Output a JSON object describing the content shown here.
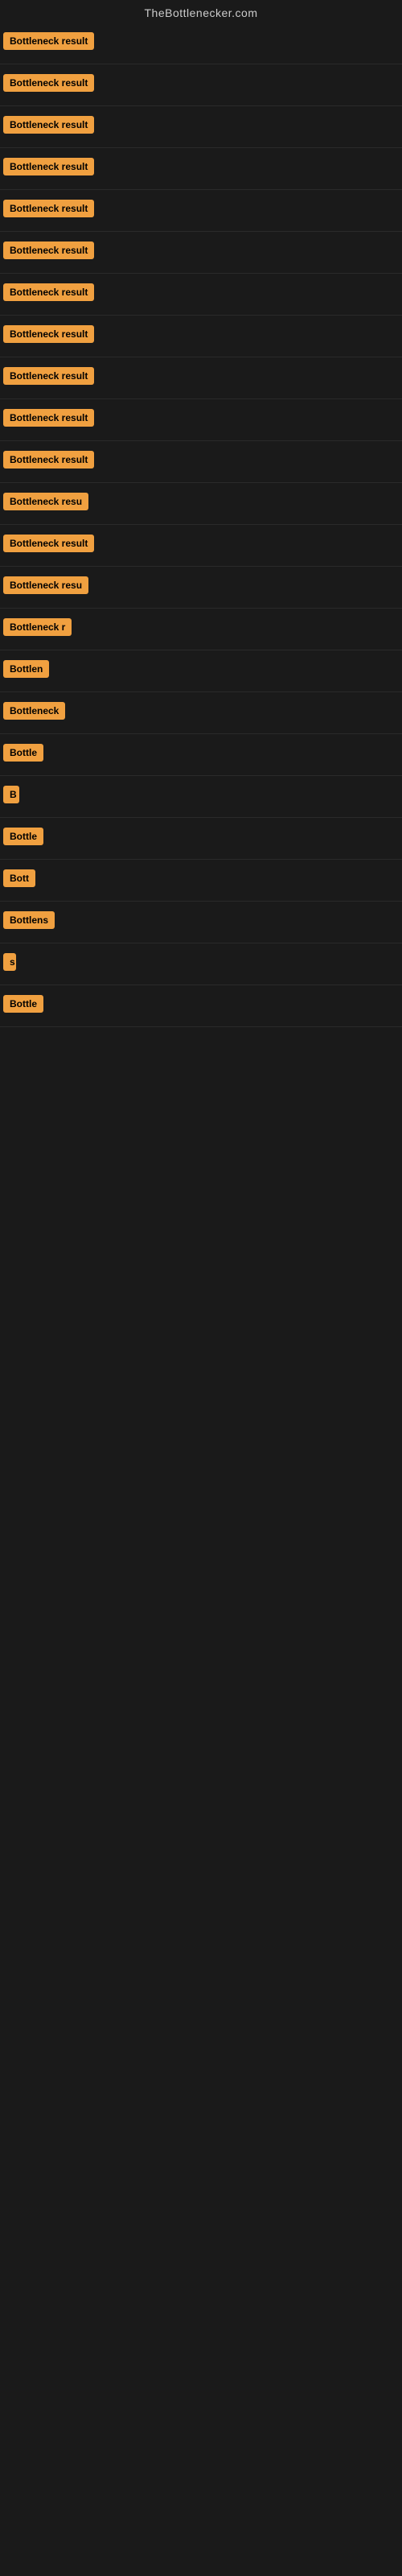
{
  "site": {
    "title": "TheBottlenecker.com"
  },
  "results": [
    {
      "id": 1,
      "label": "Bottleneck result",
      "width": 130
    },
    {
      "id": 2,
      "label": "Bottleneck result",
      "width": 130
    },
    {
      "id": 3,
      "label": "Bottleneck result",
      "width": 130
    },
    {
      "id": 4,
      "label": "Bottleneck result",
      "width": 130
    },
    {
      "id": 5,
      "label": "Bottleneck result",
      "width": 130
    },
    {
      "id": 6,
      "label": "Bottleneck result",
      "width": 130
    },
    {
      "id": 7,
      "label": "Bottleneck result",
      "width": 130
    },
    {
      "id": 8,
      "label": "Bottleneck result",
      "width": 130
    },
    {
      "id": 9,
      "label": "Bottleneck result",
      "width": 130
    },
    {
      "id": 10,
      "label": "Bottleneck result",
      "width": 130
    },
    {
      "id": 11,
      "label": "Bottleneck result",
      "width": 130
    },
    {
      "id": 12,
      "label": "Bottleneck resu",
      "width": 115
    },
    {
      "id": 13,
      "label": "Bottleneck result",
      "width": 130
    },
    {
      "id": 14,
      "label": "Bottleneck resu",
      "width": 110
    },
    {
      "id": 15,
      "label": "Bottleneck r",
      "width": 90
    },
    {
      "id": 16,
      "label": "Bottlen",
      "width": 68
    },
    {
      "id": 17,
      "label": "Bottleneck",
      "width": 78
    },
    {
      "id": 18,
      "label": "Bottle",
      "width": 55
    },
    {
      "id": 19,
      "label": "B",
      "width": 20
    },
    {
      "id": 20,
      "label": "Bottle",
      "width": 55
    },
    {
      "id": 21,
      "label": "Bott",
      "width": 42
    },
    {
      "id": 22,
      "label": "Bottlens",
      "width": 65
    },
    {
      "id": 23,
      "label": "s",
      "width": 16
    },
    {
      "id": 24,
      "label": "Bottle",
      "width": 55
    }
  ],
  "colors": {
    "badge_bg": "#f0a040",
    "badge_text": "#000000",
    "body_bg": "#1a1a1a",
    "site_title": "#cccccc"
  }
}
